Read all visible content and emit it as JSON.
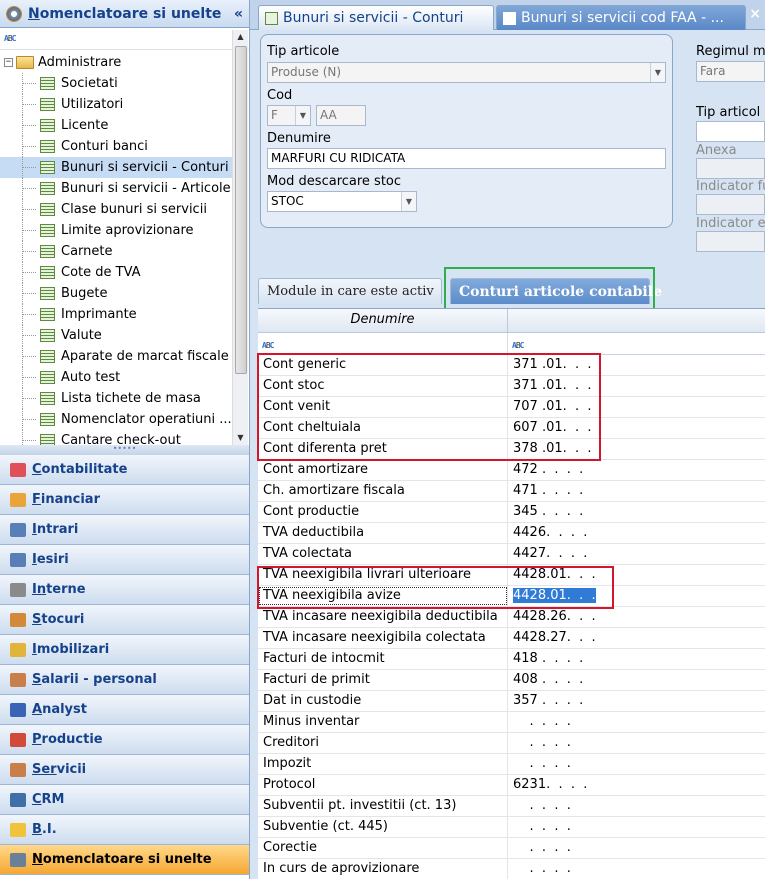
{
  "left_panel": {
    "title": "Nomenclatoare si unelte",
    "title_underlined": "N",
    "title_rest": "omenclatoare si unelte",
    "collapse_glyph": "«",
    "search_icon": "abc-filter-icon",
    "tree": {
      "root_label": "Administrare",
      "root_toggle": "−",
      "items": [
        {
          "label": "Societati",
          "selected": false
        },
        {
          "label": "Utilizatori",
          "selected": false
        },
        {
          "label": "Licente",
          "selected": false
        },
        {
          "label": "Conturi banci",
          "selected": false
        },
        {
          "label": "Bunuri si servicii - Conturi",
          "selected": true
        },
        {
          "label": "Bunuri si servicii - Articole",
          "selected": false
        },
        {
          "label": "Clase bunuri si servicii",
          "selected": false
        },
        {
          "label": "Limite aprovizionare",
          "selected": false
        },
        {
          "label": "Carnete",
          "selected": false
        },
        {
          "label": "Cote de TVA",
          "selected": false
        },
        {
          "label": "Bugete",
          "selected": false
        },
        {
          "label": "Imprimante",
          "selected": false
        },
        {
          "label": "Valute",
          "selected": false
        },
        {
          "label": "Aparate de marcat fiscale",
          "selected": false
        },
        {
          "label": "Auto test",
          "selected": false
        },
        {
          "label": "Lista tichete de masa",
          "selected": false
        },
        {
          "label": "Nomenclator operatiuni ...",
          "selected": false
        },
        {
          "label": "Cantare check-out",
          "selected": false
        }
      ]
    },
    "splitter_glyph": "•••••",
    "nav": [
      {
        "key": "C",
        "rest": "ontabilitate",
        "icon": "ledger-icon",
        "color": "#e0505a"
      },
      {
        "key": "F",
        "rest": "inanciar",
        "icon": "money-icon",
        "color": "#e8a53a"
      },
      {
        "key": "I",
        "rest": "ntrari",
        "icon": "truck-in-icon",
        "color": "#5a7fb6"
      },
      {
        "key": "I",
        "rest": "esiri",
        "icon": "truck-out-icon",
        "color": "#5a7fb6"
      },
      {
        "key": "In",
        "rest": "terne",
        "icon": "paperclip-icon",
        "color": "#8a8a8a",
        "key_prefix": "",
        "underline_index": 1
      },
      {
        "key": "S",
        "rest": "tocuri",
        "icon": "boxes-icon",
        "color": "#d28a3a"
      },
      {
        "key": "I",
        "rest": "mobilizari",
        "icon": "drill-icon",
        "color": "#e2b53a"
      },
      {
        "key": "S",
        "rest": "alarii - personal",
        "icon": "person-icon",
        "color": "#c97f4a"
      },
      {
        "key": "A",
        "rest": "nalyst",
        "icon": "analyst-icon",
        "color": "#3a62b5"
      },
      {
        "key": "P",
        "rest": "roductie",
        "icon": "factory-icon",
        "color": "#d24a3a"
      },
      {
        "key": "Ser",
        "rest": "vicii",
        "icon": "service-icon",
        "color": "#c97f4a"
      },
      {
        "key": "C",
        "rest": "RM",
        "icon": "crm-icon",
        "color": "#3f6fa8"
      },
      {
        "key": "B",
        "rest": ".I.",
        "icon": "lightbulb-icon",
        "color": "#f0c43a"
      },
      {
        "key": "N",
        "rest": "omenclatoare si unelte",
        "icon": "gear-icon",
        "color": "#6a7f98",
        "active": true
      }
    ],
    "nav_labels": [
      "Contabilitate",
      "Financiar",
      "Intrari",
      "Iesiri",
      "Interne",
      "Stocuri",
      "Imobilizari",
      "Salarii - personal",
      "Analyst",
      "Productie",
      "Servicii",
      "CRM",
      "B.I.",
      "Nomenclatoare si unelte"
    ]
  },
  "tabs": {
    "tab1": "Bunuri si servicii - Conturi",
    "tab2": "Bunuri si servicii cod FAA - ...",
    "close": "×"
  },
  "form": {
    "tip_articole_label": "Tip articole",
    "tip_articole_value": "Produse (N)",
    "cod_label": "Cod",
    "cod_part1": "F",
    "cod_part2": "AA",
    "denumire_label": "Denumire",
    "denumire_value": "MARFURI CU RIDICATA",
    "mod_descarcare_label": "Mod descarcare stoc",
    "mod_descarcare_value": "STOC",
    "regim_label": "Regimul ma",
    "regim_value": "Fara",
    "tip_articol_label": "Tip articol",
    "anexa_label": "Anexa",
    "indicator_f_label": "Indicator fu",
    "indicator_e_label": "Indicator e"
  },
  "subtabs": {
    "module": "Module in care este activ",
    "conturi": "Conturi articole contabile"
  },
  "grid": {
    "header_denumire": "Denumire",
    "rows": [
      {
        "name": "Cont generic",
        "value": "371 .01.  .  ."
      },
      {
        "name": "Cont stoc",
        "value": "371 .01.  .  ."
      },
      {
        "name": "Cont venit",
        "value": "707 .01.  .  ."
      },
      {
        "name": "Cont cheltuiala",
        "value": "607 .01.  .  ."
      },
      {
        "name": "Cont diferenta pret",
        "value": "378 .01.  .  ."
      },
      {
        "name": "Cont amortizare",
        "value": "472 .  .  .  ."
      },
      {
        "name": "Ch. amortizare fiscala",
        "value": "471 .  .  .  ."
      },
      {
        "name": "Cont productie",
        "value": "345 .  .  .  ."
      },
      {
        "name": "TVA deductibila",
        "value": "4426.  .  .  ."
      },
      {
        "name": "TVA colectata",
        "value": "4427.  .  .  ."
      },
      {
        "name": "TVA neexigibila livrari ulterioare",
        "value": "4428.01.  .  ."
      },
      {
        "name": "TVA neexigibila avize",
        "value": "4428.01.  .  .",
        "selected": true
      },
      {
        "name": "TVA incasare neexigibila deductibila",
        "value": "4428.26.  .  ."
      },
      {
        "name": "TVA incasare neexigibila colectata",
        "value": "4428.27.  .  ."
      },
      {
        "name": "Facturi de intocmit",
        "value": "418 .  .  .  ."
      },
      {
        "name": "Facturi de primit",
        "value": "408 .  .  .  ."
      },
      {
        "name": "Dat in custodie",
        "value": "357 .  .  .  ."
      },
      {
        "name": "Minus inventar",
        "value": "    .  .  .  ."
      },
      {
        "name": "Creditori",
        "value": "    .  .  .  ."
      },
      {
        "name": "Impozit",
        "value": "    .  .  .  ."
      },
      {
        "name": "Protocol",
        "value": "6231.  .  .  ."
      },
      {
        "name": "Subventii pt. investitii (ct. 13)",
        "value": "    .  .  .  ."
      },
      {
        "name": "Subventie (ct. 445)",
        "value": "    .  .  .  ."
      },
      {
        "name": "Corectie",
        "value": "    .  .  .  ."
      },
      {
        "name": "In curs de aprovizionare",
        "value": "    .  .  .  ."
      }
    ]
  },
  "colors": {
    "highlight_red": "#d3162b",
    "highlight_green": "#2fae4c",
    "active_nav": "#f5a731",
    "selection_blue": "#2f7bd6"
  }
}
